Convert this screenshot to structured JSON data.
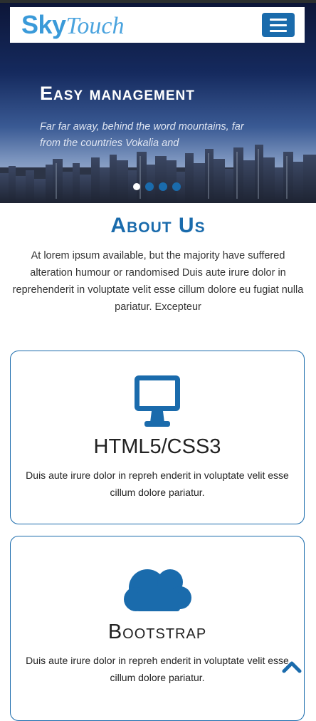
{
  "brand": {
    "logo_part1": "Sky",
    "logo_part2": "Touch"
  },
  "hero": {
    "title": "Easy management",
    "text": "Far far away, behind the word mountains, far from the countries Vokalia and",
    "slides": 4,
    "active_slide": 1
  },
  "about": {
    "title": "About Us",
    "text": "At lorem ipsum available, but the majority have suffered alteration humour or randomised Duis aute irure dolor in reprehenderit in voluptate velit esse cillum dolore eu fugiat nulla pariatur. Excepteur"
  },
  "features": [
    {
      "icon": "monitor-icon",
      "title": "HTML5/CSS3",
      "text": "Duis aute irure dolor in repreh enderit in voluptate velit esse cillum dolore pariatur."
    },
    {
      "icon": "cloud-icon",
      "title": "Bootstrap",
      "text": "Duis aute irure dolor in repreh enderit in voluptate velit esse cillum dolore pariatur."
    }
  ],
  "colors": {
    "accent": "#1a6bac",
    "logo": "#3a9ad9",
    "hero_dark": "#0d1638"
  },
  "icons": {
    "menu": "hamburger-icon",
    "scroll_top": "chevron-up-icon"
  }
}
